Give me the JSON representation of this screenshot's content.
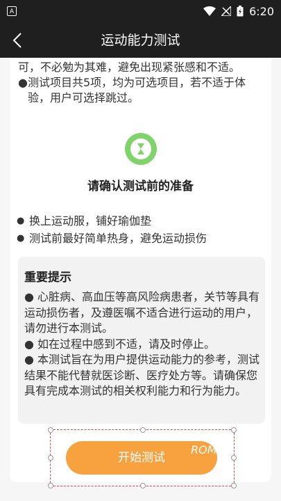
{
  "status_bar": {
    "time": "6:20",
    "left_icon_letter": "A"
  },
  "header": {
    "title": "运动能力测试"
  },
  "intro": {
    "line_cont": "可，不必勉为其难，避免出现紧张感和不适。",
    "bullet_text": "测试项目共5项，均为可选项目，若不适于体验，用户可选择跳过。"
  },
  "prep": {
    "title": "请确认测试前的准备",
    "items": [
      "换上运动服，铺好瑜伽垫",
      "测试前最好简单热身，避免运动损伤"
    ]
  },
  "notice": {
    "title": "重要提示",
    "items": [
      "● 心脏病、高血压等高风险病患者，关节等具有运动损伤者，及遵医嘱不适合进行运动的用户，请勿进行本测试。",
      "● 如在过程中感到不适，请及时停止。",
      "● 本测试旨在为用户提供运动能力的参考，测试结果不能代替就医诊断、医疗处方等。请确保您具有完成本测试的相关权利能力和行为能力。"
    ]
  },
  "button": {
    "start_label": "开始测试",
    "overlay_tag": "ROM"
  },
  "colors": {
    "accent_orange": "#f7a23f",
    "icon_green": "#7fd36a",
    "header_bg": "#1f1f1f"
  }
}
